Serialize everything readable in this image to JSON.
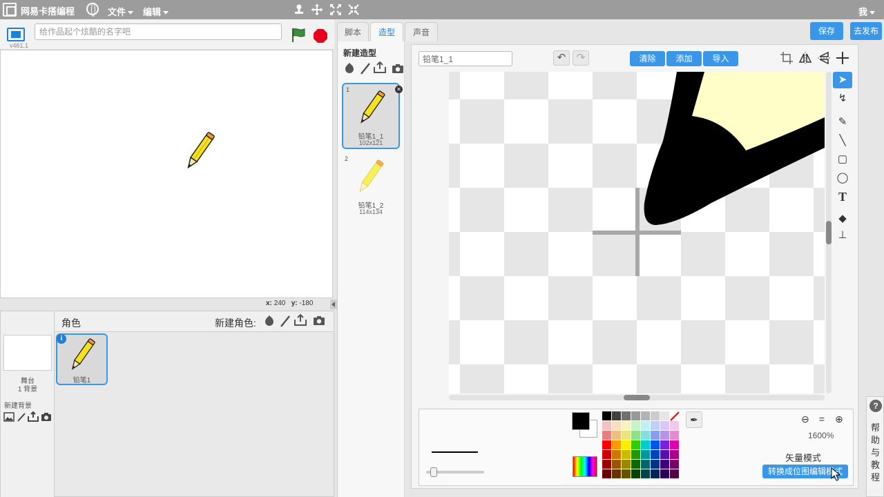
{
  "topbar": {
    "app_name": "网易卡搭编程",
    "menus": [
      "文件",
      "编辑"
    ],
    "user_label": "我"
  },
  "stage": {
    "version": "v461.1",
    "title_placeholder": "给作品起个炫酷的名字吧",
    "coords": {
      "x_label": "x:",
      "x_value": "240",
      "y_label": "y:",
      "y_value": "-180"
    }
  },
  "sprites": {
    "header_label": "角色",
    "new_sprite_label": "新建角色:",
    "stage_name": "舞台",
    "stage_backdrops": "1 背景",
    "new_backdrop_label": "新建背景",
    "items": [
      {
        "name": "铅笔1"
      }
    ]
  },
  "tabs": [
    {
      "label": "脚本",
      "active": false
    },
    {
      "label": "造型",
      "active": true
    },
    {
      "label": "声音",
      "active": false
    }
  ],
  "costumes": {
    "new_label": "新建造型",
    "items": [
      {
        "number": "1",
        "name": "铅笔1_1",
        "size": "102x121",
        "selected": true
      },
      {
        "number": "2",
        "name": "铅笔1_2",
        "size": "114x134",
        "selected": false
      }
    ]
  },
  "paint": {
    "costume_name_value": "铅笔1_1",
    "clear_label": "清除",
    "add_label": "添加",
    "import_label": "导入",
    "zoom_level": "1600%",
    "mode_label": "矢量模式",
    "convert_label": "转换成位图编辑模式",
    "primary_color": "#000000",
    "secondary_color": "#ffffff",
    "palette": [
      "#000000",
      "#404040",
      "#707070",
      "#999999",
      "#b3b3b3",
      "#cccccc",
      "#e6e6e6",
      "#ffffff",
      "#f2c2c2",
      "#f7dfbf",
      "#f7f2bf",
      "#c9f2c6",
      "#c2efef",
      "#c2cff2",
      "#d9c9f2",
      "#f2c9e6",
      "#e68080",
      "#ecc080",
      "#ece380",
      "#90e18a",
      "#85dddd",
      "#85a0e6",
      "#b394e6",
      "#e08fcc",
      "#ff0000",
      "#ff9900",
      "#ffee00",
      "#33cc00",
      "#00cccc",
      "#0055ee",
      "#7722dd",
      "#dd00aa",
      "#cc0000",
      "#cc7700",
      "#ccbb00",
      "#229900",
      "#009999",
      "#0044bb",
      "#5511aa",
      "#aa0088",
      "#990000",
      "#995500",
      "#998800",
      "#116600",
      "#006666",
      "#003388",
      "#3f0077",
      "#770066",
      "#660000",
      "#663300",
      "#665500",
      "#0b4400",
      "#004444",
      "#002255",
      "#2a0055",
      "#550044"
    ]
  },
  "actions": {
    "save_label": "保存",
    "publish_label": "去发布"
  },
  "help": {
    "chars": [
      "帮",
      "助",
      "与",
      "教",
      "程"
    ]
  }
}
